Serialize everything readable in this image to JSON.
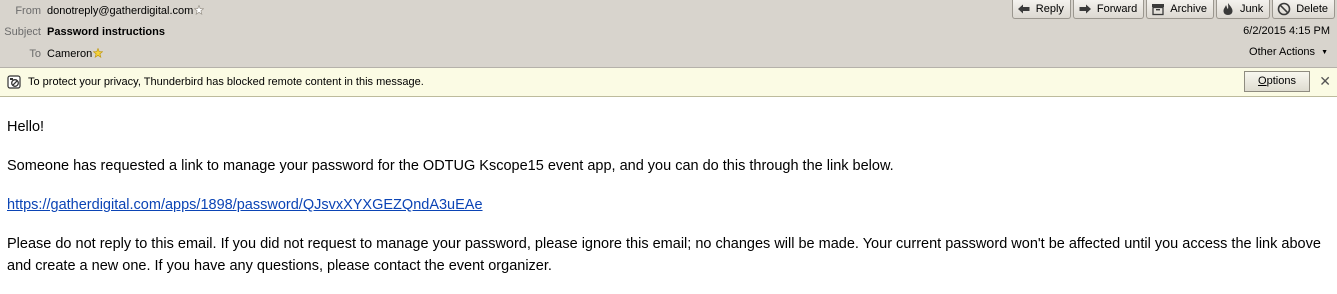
{
  "header": {
    "from_label": "From",
    "from_value": "donotreply@gatherdigital.com",
    "subject_label": "Subject",
    "subject_value": "Password instructions",
    "to_label": "To",
    "to_value": "Cameron",
    "date": "6/2/2015 4:15 PM",
    "other_actions": "Other Actions",
    "toolbar": {
      "reply": "Reply",
      "forward": "Forward",
      "archive": "Archive",
      "junk": "Junk",
      "delete": "Delete"
    }
  },
  "notice": {
    "text": "To protect your privacy, Thunderbird has blocked remote content in this message.",
    "options_first": "O",
    "options_rest": "ptions"
  },
  "message": {
    "greeting": "Hello!",
    "paragraph1": "Someone has requested a link to manage your password for the ODTUG Kscope15 event app, and you can do this through the link below.",
    "link": "https://gatherdigital.com/apps/1898/password/QJsvxXYXGEZQndA3uEAe",
    "paragraph2": "Please do not reply to this email. If you did not request to manage your password, please ignore this email; no changes will be made. Your current password won't be affected until you access the link above and create a new one. If you have any questions, please contact the event organizer."
  },
  "colors": {
    "header_bg": "#d8d4cd",
    "notice_bg": "#fbfbe4",
    "link": "#0b44b5"
  },
  "icons": [
    "star-icon",
    "reply-icon",
    "forward-icon",
    "archive-icon",
    "junk-icon",
    "delete-icon",
    "blocked-content-icon",
    "close-icon"
  ]
}
